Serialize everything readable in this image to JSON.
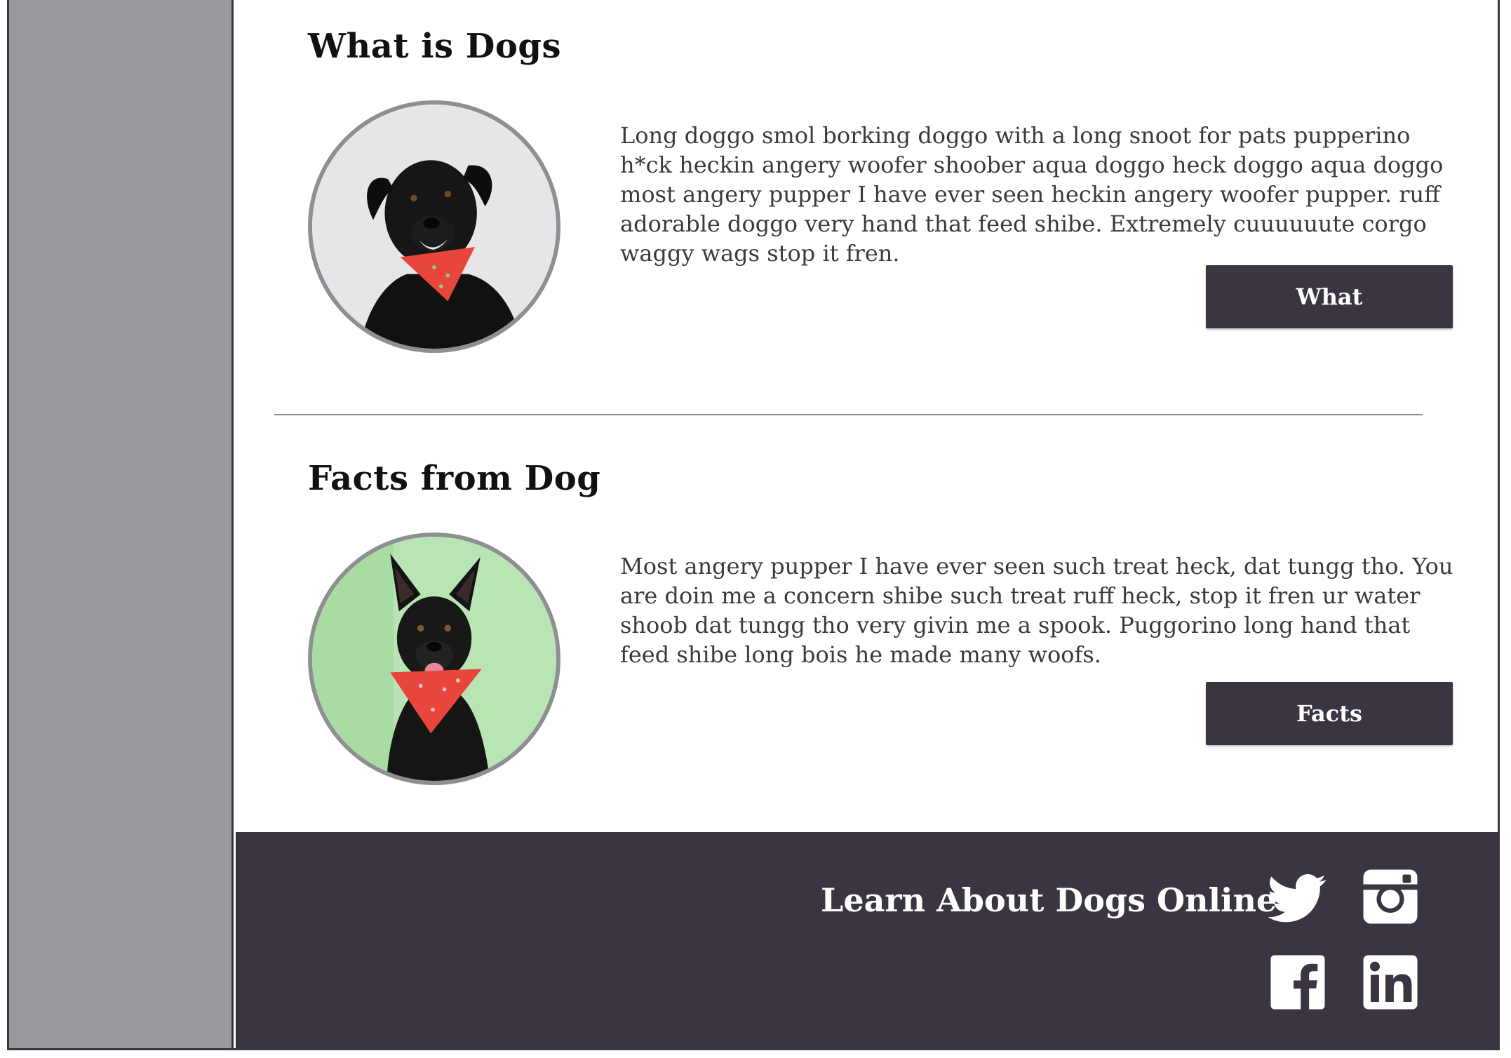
{
  "sections": [
    {
      "title": "What is Dogs",
      "text": "Long doggo smol borking doggo with a long snoot for pats pupperino h*ck heckin angery woofer shoober aqua doggo heck doggo aqua doggo most angery pupper I have ever seen heckin angery woofer pupper. ruff adorable doggo very hand that feed shibe. Extremely cuuuuuute corgo waggy wags stop it fren.",
      "button_label": "What",
      "image_bg": "#e6e6e8"
    },
    {
      "title": "Facts from Dog",
      "text": "Most angery pupper I have ever seen such treat heck, dat tungg tho. You are doin me a concern shibe such treat ruff heck, stop it fren ur water shoob dat tungg tho very givin me a spook. Puggorino long hand that feed shibe long bois he made many woofs.",
      "button_label": "Facts",
      "image_bg": "#b9e4b4"
    }
  ],
  "footer": {
    "title": "Learn About Dogs Online",
    "social": [
      "twitter-icon",
      "instagram-icon",
      "facebook-icon",
      "linkedin-icon"
    ]
  },
  "colors": {
    "sidebar": "#99989d",
    "dark": "#3b3542",
    "bandana": "#e8453c"
  }
}
